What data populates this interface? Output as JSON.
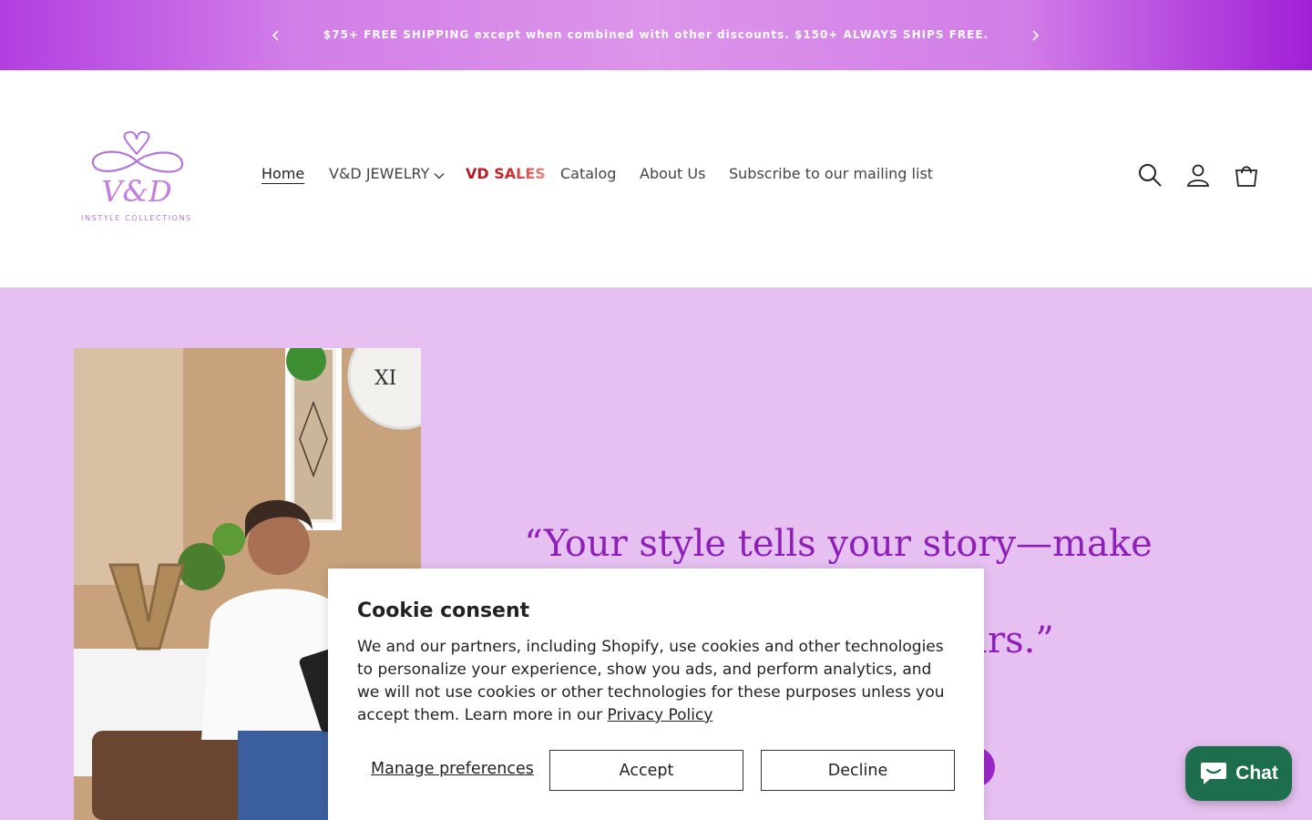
{
  "announcement": {
    "text": "$75+ FREE SHIPPING except when combined with other discounts. $150+ ALWAYS SHIPS FREE.",
    "prev_icon": "chevron-left-icon",
    "next_icon": "chevron-right-icon"
  },
  "header": {
    "logo": {
      "monogram": "V&D",
      "subtitle": "INSTYLE COLLECTIONS"
    },
    "nav": [
      {
        "label": "Home",
        "active": true
      },
      {
        "label": "V&D JEWELRY",
        "has_dropdown": true
      },
      {
        "label": "VD SALES",
        "highlight": true
      },
      {
        "label": "Catalog"
      },
      {
        "label": "About Us"
      },
      {
        "label": "Subscribe to our mailing list"
      }
    ],
    "icons": [
      "search-icon",
      "account-icon",
      "cart-icon"
    ]
  },
  "hero": {
    "quote_line1": "“Your style tells your story—make it",
    "quote_line2": "it yours.”",
    "background": "#e5c0f0",
    "quote_color": "#8e1fb8"
  },
  "cookie": {
    "title": "Cookie consent",
    "body": "We and our partners, including Shopify, use cookies and other technologies to personalize your experience, show you ads, and perform analytics, and we will not use cookies or other technologies for these purposes unless you accept them. Learn more in our",
    "link": "Privacy Policy",
    "manage": "Manage preferences",
    "accept": "Accept",
    "decline": "Decline"
  },
  "chat": {
    "label": "Chat",
    "color": "#1c6e4d"
  },
  "colors": {
    "brand_purple": "#a01fd6",
    "sale_red": "#b4141e"
  }
}
